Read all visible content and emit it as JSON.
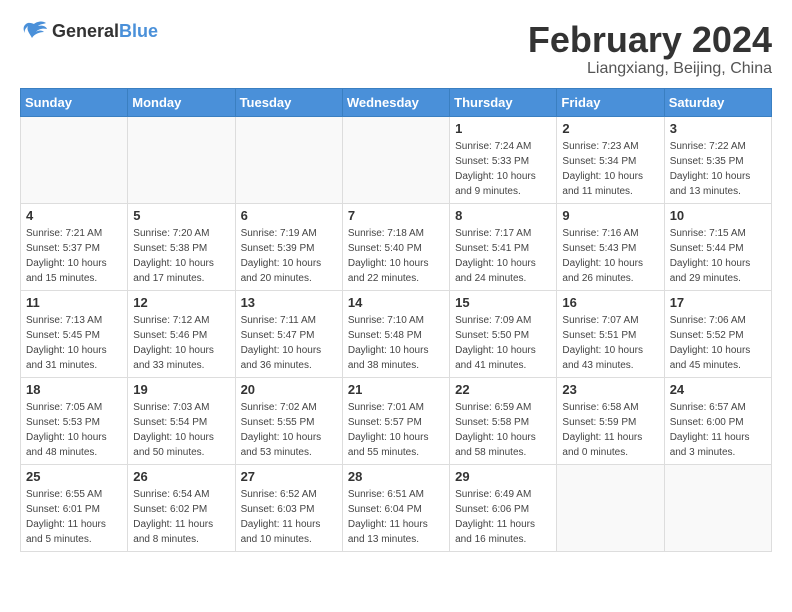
{
  "logo": {
    "text_general": "General",
    "text_blue": "Blue"
  },
  "title": {
    "month": "February 2024",
    "location": "Liangxiang, Beijing, China"
  },
  "headers": [
    "Sunday",
    "Monday",
    "Tuesday",
    "Wednesday",
    "Thursday",
    "Friday",
    "Saturday"
  ],
  "weeks": [
    [
      {
        "day": "",
        "info": ""
      },
      {
        "day": "",
        "info": ""
      },
      {
        "day": "",
        "info": ""
      },
      {
        "day": "",
        "info": ""
      },
      {
        "day": "1",
        "info": "Sunrise: 7:24 AM\nSunset: 5:33 PM\nDaylight: 10 hours\nand 9 minutes."
      },
      {
        "day": "2",
        "info": "Sunrise: 7:23 AM\nSunset: 5:34 PM\nDaylight: 10 hours\nand 11 minutes."
      },
      {
        "day": "3",
        "info": "Sunrise: 7:22 AM\nSunset: 5:35 PM\nDaylight: 10 hours\nand 13 minutes."
      }
    ],
    [
      {
        "day": "4",
        "info": "Sunrise: 7:21 AM\nSunset: 5:37 PM\nDaylight: 10 hours\nand 15 minutes."
      },
      {
        "day": "5",
        "info": "Sunrise: 7:20 AM\nSunset: 5:38 PM\nDaylight: 10 hours\nand 17 minutes."
      },
      {
        "day": "6",
        "info": "Sunrise: 7:19 AM\nSunset: 5:39 PM\nDaylight: 10 hours\nand 20 minutes."
      },
      {
        "day": "7",
        "info": "Sunrise: 7:18 AM\nSunset: 5:40 PM\nDaylight: 10 hours\nand 22 minutes."
      },
      {
        "day": "8",
        "info": "Sunrise: 7:17 AM\nSunset: 5:41 PM\nDaylight: 10 hours\nand 24 minutes."
      },
      {
        "day": "9",
        "info": "Sunrise: 7:16 AM\nSunset: 5:43 PM\nDaylight: 10 hours\nand 26 minutes."
      },
      {
        "day": "10",
        "info": "Sunrise: 7:15 AM\nSunset: 5:44 PM\nDaylight: 10 hours\nand 29 minutes."
      }
    ],
    [
      {
        "day": "11",
        "info": "Sunrise: 7:13 AM\nSunset: 5:45 PM\nDaylight: 10 hours\nand 31 minutes."
      },
      {
        "day": "12",
        "info": "Sunrise: 7:12 AM\nSunset: 5:46 PM\nDaylight: 10 hours\nand 33 minutes."
      },
      {
        "day": "13",
        "info": "Sunrise: 7:11 AM\nSunset: 5:47 PM\nDaylight: 10 hours\nand 36 minutes."
      },
      {
        "day": "14",
        "info": "Sunrise: 7:10 AM\nSunset: 5:48 PM\nDaylight: 10 hours\nand 38 minutes."
      },
      {
        "day": "15",
        "info": "Sunrise: 7:09 AM\nSunset: 5:50 PM\nDaylight: 10 hours\nand 41 minutes."
      },
      {
        "day": "16",
        "info": "Sunrise: 7:07 AM\nSunset: 5:51 PM\nDaylight: 10 hours\nand 43 minutes."
      },
      {
        "day": "17",
        "info": "Sunrise: 7:06 AM\nSunset: 5:52 PM\nDaylight: 10 hours\nand 45 minutes."
      }
    ],
    [
      {
        "day": "18",
        "info": "Sunrise: 7:05 AM\nSunset: 5:53 PM\nDaylight: 10 hours\nand 48 minutes."
      },
      {
        "day": "19",
        "info": "Sunrise: 7:03 AM\nSunset: 5:54 PM\nDaylight: 10 hours\nand 50 minutes."
      },
      {
        "day": "20",
        "info": "Sunrise: 7:02 AM\nSunset: 5:55 PM\nDaylight: 10 hours\nand 53 minutes."
      },
      {
        "day": "21",
        "info": "Sunrise: 7:01 AM\nSunset: 5:57 PM\nDaylight: 10 hours\nand 55 minutes."
      },
      {
        "day": "22",
        "info": "Sunrise: 6:59 AM\nSunset: 5:58 PM\nDaylight: 10 hours\nand 58 minutes."
      },
      {
        "day": "23",
        "info": "Sunrise: 6:58 AM\nSunset: 5:59 PM\nDaylight: 11 hours\nand 0 minutes."
      },
      {
        "day": "24",
        "info": "Sunrise: 6:57 AM\nSunset: 6:00 PM\nDaylight: 11 hours\nand 3 minutes."
      }
    ],
    [
      {
        "day": "25",
        "info": "Sunrise: 6:55 AM\nSunset: 6:01 PM\nDaylight: 11 hours\nand 5 minutes."
      },
      {
        "day": "26",
        "info": "Sunrise: 6:54 AM\nSunset: 6:02 PM\nDaylight: 11 hours\nand 8 minutes."
      },
      {
        "day": "27",
        "info": "Sunrise: 6:52 AM\nSunset: 6:03 PM\nDaylight: 11 hours\nand 10 minutes."
      },
      {
        "day": "28",
        "info": "Sunrise: 6:51 AM\nSunset: 6:04 PM\nDaylight: 11 hours\nand 13 minutes."
      },
      {
        "day": "29",
        "info": "Sunrise: 6:49 AM\nSunset: 6:06 PM\nDaylight: 11 hours\nand 16 minutes."
      },
      {
        "day": "",
        "info": ""
      },
      {
        "day": "",
        "info": ""
      }
    ]
  ]
}
